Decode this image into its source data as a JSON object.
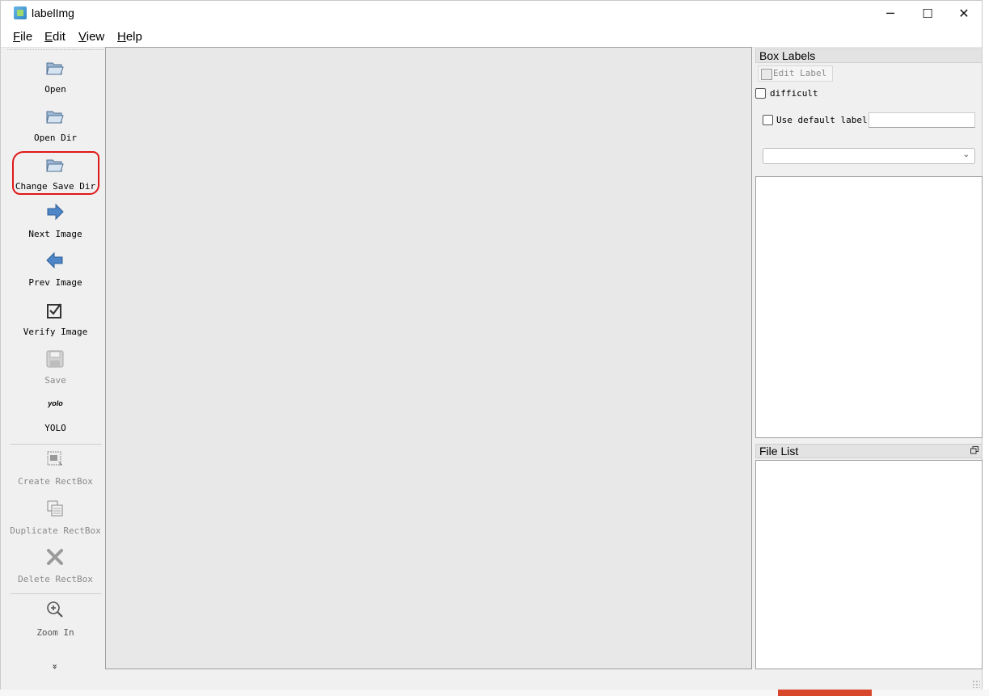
{
  "window": {
    "title": "labelImg",
    "controls": {
      "minimize": "─",
      "maximize": "☐",
      "close": "✕"
    }
  },
  "menu": [
    {
      "label": "File",
      "mnemonic": "F",
      "rest": "ile"
    },
    {
      "label": "Edit",
      "mnemonic": "E",
      "rest": "dit"
    },
    {
      "label": "View",
      "mnemonic": "V",
      "rest": "iew"
    },
    {
      "label": "Help",
      "mnemonic": "H",
      "rest": "elp"
    }
  ],
  "toolbar": {
    "open": "Open",
    "open_dir": "Open Dir",
    "change_save_dir": "Change Save Dir",
    "next_image": "Next Image",
    "prev_image": "Prev Image",
    "verify_image": "Verify Image",
    "save": "Save",
    "yolo_icon_text": "yolo",
    "yolo": "YOLO",
    "create_rectbox": "Create RectBox",
    "duplicate_rectbox": "Duplicate RectBox",
    "delete_rectbox": "Delete RectBox",
    "zoom_in": "Zoom In",
    "more": "»"
  },
  "box_labels": {
    "title": "Box Labels",
    "edit_label": "Edit Label",
    "difficult": "difficult",
    "use_default_label": "Use default label",
    "default_label_value": "",
    "combo_value": ""
  },
  "file_list": {
    "title": "File List"
  },
  "colors": {
    "highlight": "#e01818",
    "canvas": "#e8e8e8",
    "dock_title": "#e3e3e3"
  }
}
